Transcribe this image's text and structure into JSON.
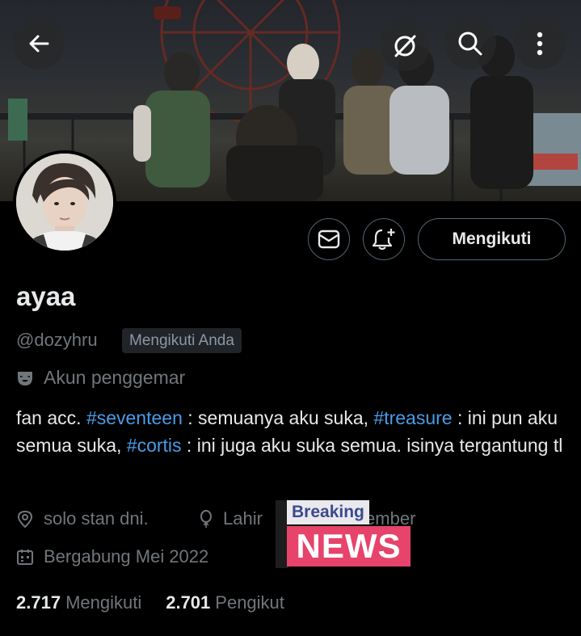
{
  "profile": {
    "name": "ayaa",
    "handle": "@dozyhru",
    "follows_you_badge": "Mengikuti Anda",
    "category": "Akun penggemar",
    "bio": {
      "p1": "fan acc. ",
      "h1": "#seventeen",
      "p2": " : semuanya aku suka, ",
      "h2": "#treasure",
      "p3": " : ini pun aku semua suka, ",
      "h3": "#cortis",
      "p4": " : ini juga aku suka semua. isinya tergantung tl"
    },
    "location": "solo stan dni.",
    "birth_label": "Lahir",
    "birth_date_visible": "December",
    "joined": "Bergabung Mei 2022",
    "following_count": "2.717",
    "following_label": "Mengikuti",
    "followers_count": "2.701",
    "followers_label": "Pengikut"
  },
  "actions": {
    "follow_label": "Mengikuti"
  },
  "overlay": {
    "tag": "Breaking",
    "headline": "NEWS"
  },
  "icons": {
    "back": "arrow-left-icon",
    "grok": "grok-icon",
    "search": "search-icon",
    "more": "more-vertical-icon",
    "message": "envelope-icon",
    "notify": "bell-plus-icon",
    "category": "theater-mask-icon",
    "location": "location-pin-icon",
    "birth": "balloon-icon",
    "joined": "calendar-icon"
  },
  "colors": {
    "background": "#000000",
    "text_primary": "#e7e9ea",
    "text_secondary": "#71767b",
    "link": "#4a9ce8",
    "badge_bg": "#202327",
    "news_pink": "#e6446b"
  }
}
